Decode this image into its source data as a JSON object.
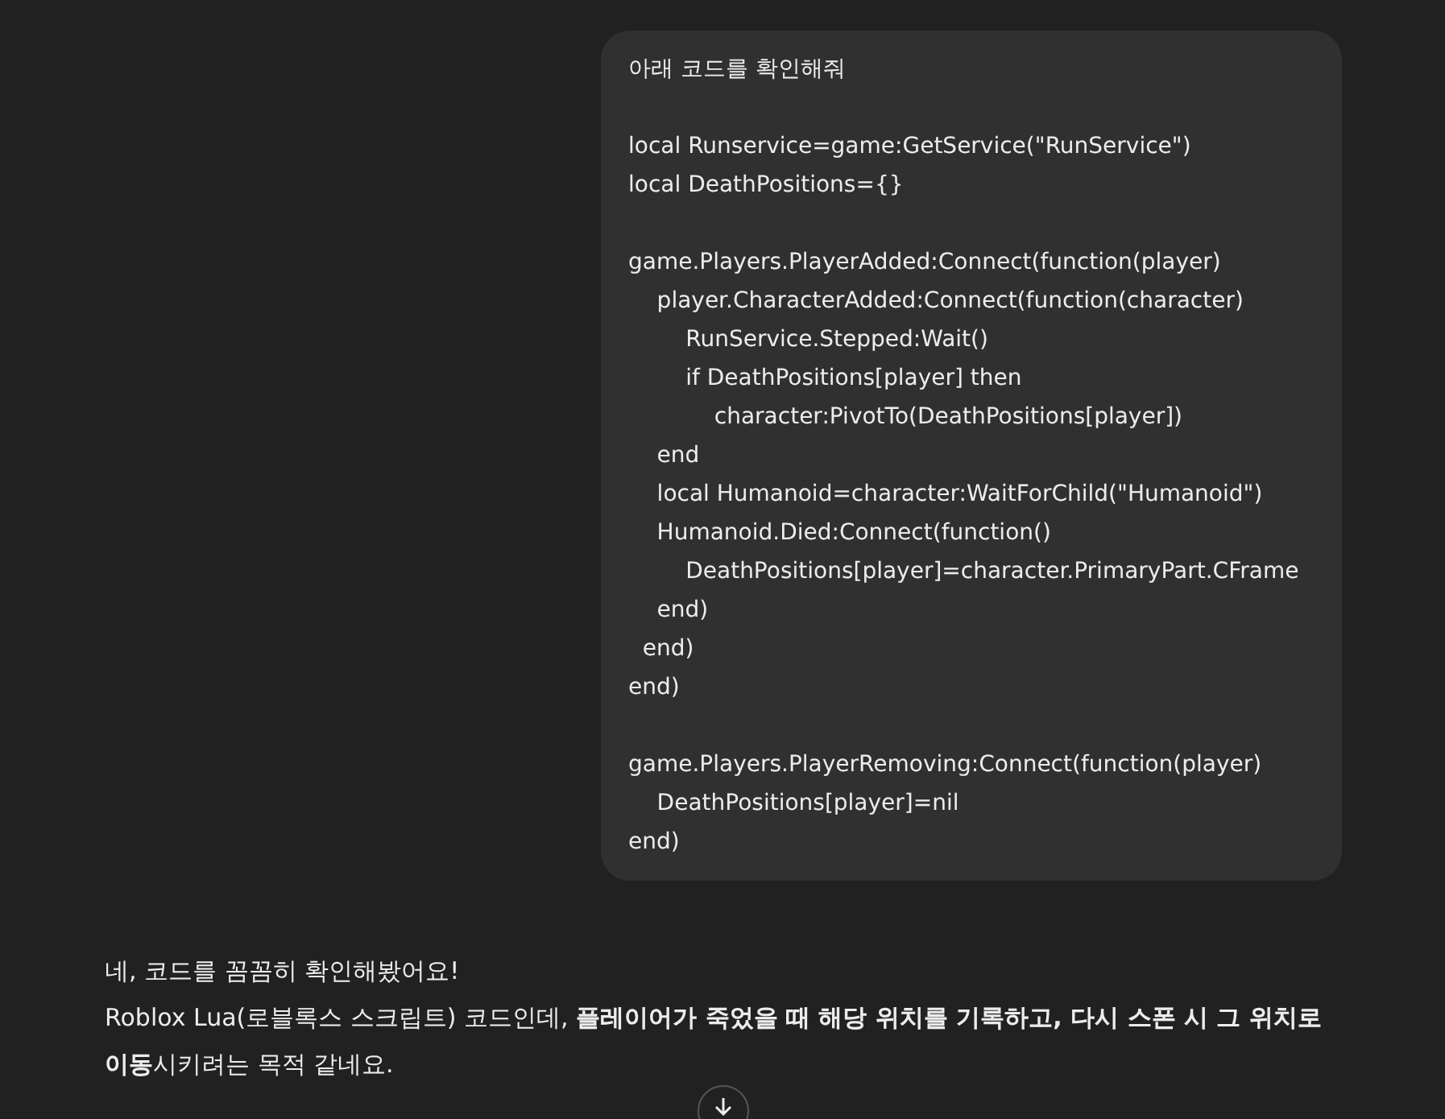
{
  "user_message": {
    "blocks": [
      [
        "아래 코드를 확인해줘"
      ],
      [
        "local Runservice=game:GetService(\"RunService\")",
        "local DeathPositions={}"
      ],
      [
        "game.Players.PlayerAdded:Connect(function(player)",
        "    player.CharacterAdded:Connect(function(character)",
        "        RunService.Stepped:Wait()",
        "        if DeathPositions[player] then",
        "            character:PivotTo(DeathPositions[player])",
        "    end",
        "    local Humanoid=character:WaitForChild(\"Humanoid\")",
        "    Humanoid.Died:Connect(function()",
        "        DeathPositions[player]=character.PrimaryPart.CFrame",
        "    end)",
        "  end)",
        "end)"
      ],
      [
        "game.Players.PlayerRemoving:Connect(function(player)",
        "    DeathPositions[player]=nil",
        "end)"
      ]
    ]
  },
  "assistant_message": {
    "paragraphs": [
      "네, 코드를 꼼꼼히 확인해봤어요!",
      "Roblox Lua(로블록스 스크립트) 코드인데, **플레이어가 죽었을 때 해당 위치를 기록하고, 다시 스폰 시 그 위치로 이동**시키려는 목적 같네요."
    ]
  }
}
